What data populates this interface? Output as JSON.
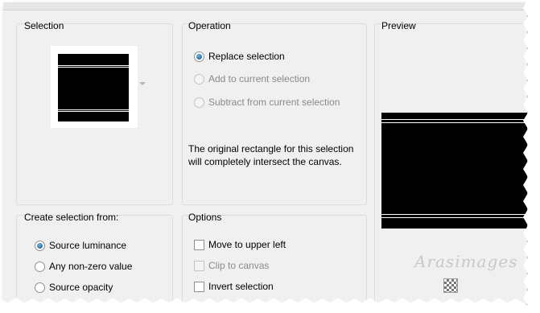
{
  "selection_group": {
    "title": "Selection"
  },
  "operation_group": {
    "title": "Operation",
    "options": [
      {
        "label": "Replace selection",
        "checked": true,
        "enabled": true
      },
      {
        "label": "Add to current selection",
        "checked": false,
        "enabled": false
      },
      {
        "label": "Subtract from current selection",
        "checked": false,
        "enabled": false
      }
    ],
    "note": "The original rectangle for this selection will completely intersect the canvas."
  },
  "preview_group": {
    "title": "Preview"
  },
  "create_from_group": {
    "title": "Create selection from:",
    "options": [
      {
        "label": "Source luminance",
        "checked": true
      },
      {
        "label": "Any non-zero value",
        "checked": false
      },
      {
        "label": "Source opacity",
        "checked": false
      }
    ]
  },
  "options_group": {
    "title": "Options",
    "items": [
      {
        "label": "Move to upper left",
        "checked": false,
        "enabled": true
      },
      {
        "label": "Clip to canvas",
        "checked": false,
        "enabled": false
      },
      {
        "label": "Invert selection",
        "checked": false,
        "enabled": true
      }
    ]
  },
  "watermark": "Arasimages",
  "icons": {
    "dropdown": "dropdown-caret-icon",
    "transparency": "transparency-checker-icon"
  },
  "colors": {
    "radio_accent": "#0b4d86",
    "panel_bg": "#f0f0f0",
    "border": "#dcdcdc"
  }
}
